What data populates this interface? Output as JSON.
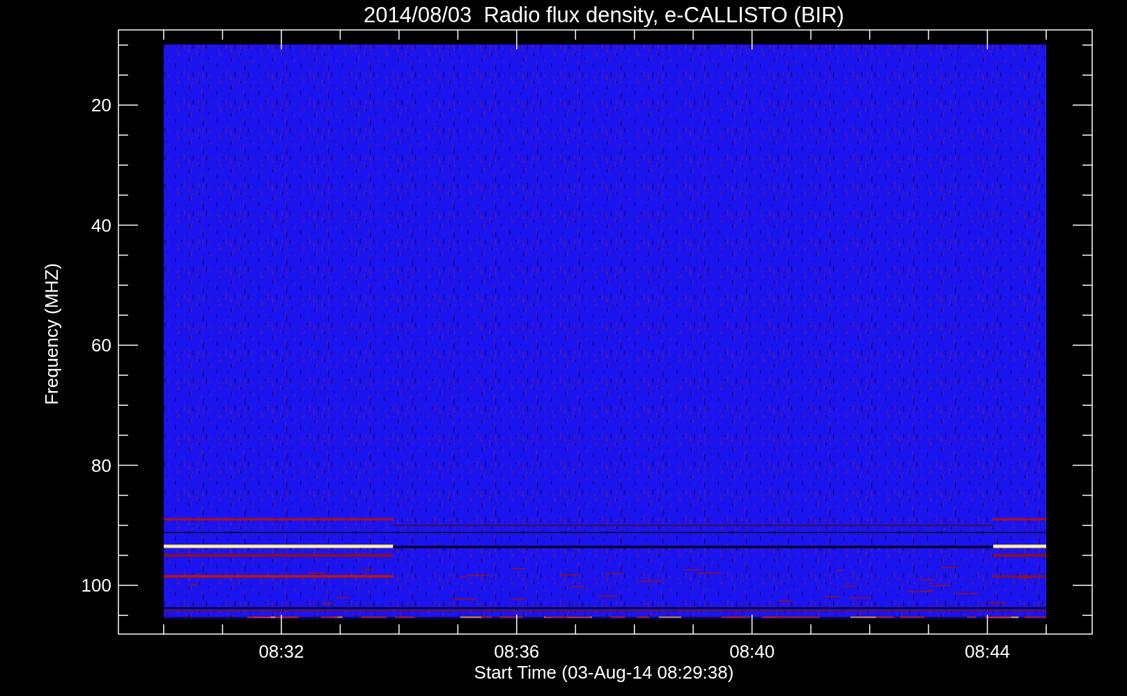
{
  "plot": {
    "title": "2014/08/03  Radio flux density, e-CALLISTO (BIR)",
    "ylabel": "Frequency (MHZ)",
    "xlabel": "Start Time (03-Aug-14 08:29:38)",
    "yticks": [
      "20",
      "40",
      "60",
      "80",
      "100"
    ],
    "xticks": [
      "08:32",
      "08:36",
      "08:40",
      "08:44"
    ]
  }
}
